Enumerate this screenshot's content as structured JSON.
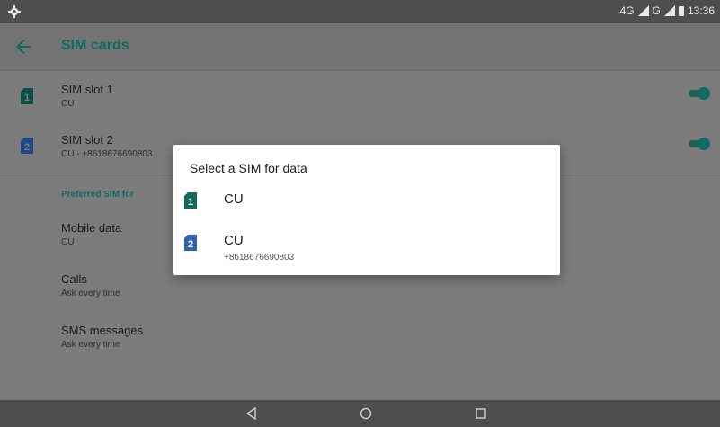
{
  "status_bar": {
    "network_text": "4G",
    "network2": "G",
    "time": "13:36"
  },
  "app_bar": {
    "title": "SIM cards"
  },
  "sim_slots": [
    {
      "icon_number": "1",
      "title": "SIM slot 1",
      "subtitle": "CU",
      "icon_color": "#0f6b5f"
    },
    {
      "icon_number": "2",
      "title": "SIM slot 2",
      "subtitle": "CU - +8618676690803",
      "icon_color": "#2f63b8"
    }
  ],
  "preferred": {
    "header": "Preferred SIM for",
    "items": [
      {
        "title": "Mobile data",
        "subtitle": "CU"
      },
      {
        "title": "Calls",
        "subtitle": "Ask every time"
      },
      {
        "title": "SMS messages",
        "subtitle": "Ask every time"
      }
    ]
  },
  "dialog": {
    "title": "Select a SIM for data",
    "options": [
      {
        "icon_number": "1",
        "label": "CU",
        "sub": "",
        "icon_color": "#0f6b5f"
      },
      {
        "icon_number": "2",
        "label": "CU",
        "sub": "+8618676690803",
        "icon_color": "#2f63b8"
      }
    ]
  },
  "colors": {
    "accent": "#0f6b5f",
    "sim2": "#2f63b8"
  }
}
